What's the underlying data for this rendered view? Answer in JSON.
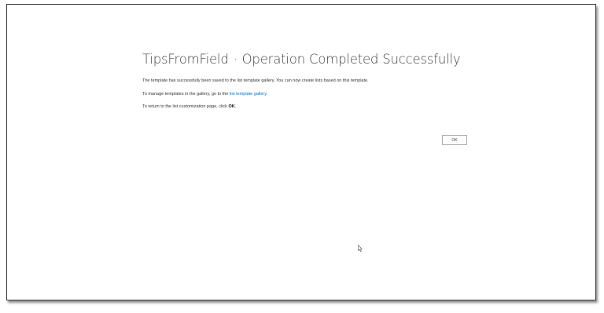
{
  "page": {
    "title_site": "TipsFromField",
    "title_separator": "·",
    "title_text": "Operation Completed Successfully"
  },
  "messages": {
    "line1": "The template has successfully been saved to the list template gallery. You can now create lists based on this template.",
    "line2_prefix": "To manage templates in the gallery, go to the ",
    "line2_link": "list template gallery",
    "line2_suffix": ".",
    "line3_prefix": "To return to the list customization page, click ",
    "line3_bold": "OK",
    "line3_suffix": "."
  },
  "buttons": {
    "ok_label": "OK"
  },
  "colors": {
    "link": "#0072c6",
    "title": "#444444",
    "text": "#333333"
  },
  "icons": {
    "cursor": "mouse-pointer-icon"
  }
}
